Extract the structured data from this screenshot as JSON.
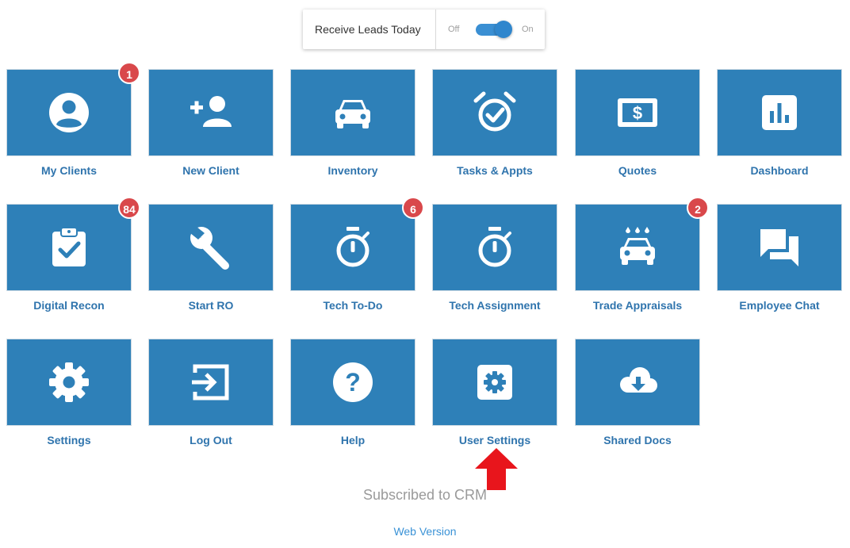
{
  "header": {
    "receive_leads_label": "Receive Leads Today",
    "toggle_off_label": "Off",
    "toggle_on_label": "On",
    "toggle_state": "on"
  },
  "colors": {
    "tile_background": "#2e80b8",
    "tile_label": "#2f74ad",
    "badge": "#d9484b",
    "link": "#3a92d6",
    "arrow": "#e8151c"
  },
  "tiles": [
    {
      "label": "My Clients",
      "icon": "account-circle-icon",
      "badge": "1"
    },
    {
      "label": "New Client",
      "icon": "add-person-icon",
      "badge": ""
    },
    {
      "label": "Inventory",
      "icon": "car-icon",
      "badge": ""
    },
    {
      "label": "Tasks & Appts",
      "icon": "alarm-check-icon",
      "badge": ""
    },
    {
      "label": "Quotes",
      "icon": "dollar-bill-icon",
      "badge": ""
    },
    {
      "label": "Dashboard",
      "icon": "bar-chart-icon",
      "badge": ""
    },
    {
      "label": "Digital Recon",
      "icon": "clipboard-check-icon",
      "badge": "84"
    },
    {
      "label": "Start RO",
      "icon": "wrench-icon",
      "badge": ""
    },
    {
      "label": "Tech To-Do",
      "icon": "stopwatch-icon",
      "badge": "6"
    },
    {
      "label": "Tech Assignment",
      "icon": "stopwatch-icon",
      "badge": ""
    },
    {
      "label": "Trade Appraisals",
      "icon": "car-wash-icon",
      "badge": "2"
    },
    {
      "label": "Employee Chat",
      "icon": "chat-bubbles-icon",
      "badge": ""
    },
    {
      "label": "Settings",
      "icon": "gear-icon",
      "badge": ""
    },
    {
      "label": "Log Out",
      "icon": "exit-icon",
      "badge": ""
    },
    {
      "label": "Help",
      "icon": "question-circle-icon",
      "badge": ""
    },
    {
      "label": "User Settings",
      "icon": "settings-box-icon",
      "badge": ""
    },
    {
      "label": "Shared Docs",
      "icon": "cloud-download-icon",
      "badge": ""
    }
  ],
  "footer": {
    "subscription_text": "Subscribed to CRM",
    "web_version_link": "Web Version"
  }
}
